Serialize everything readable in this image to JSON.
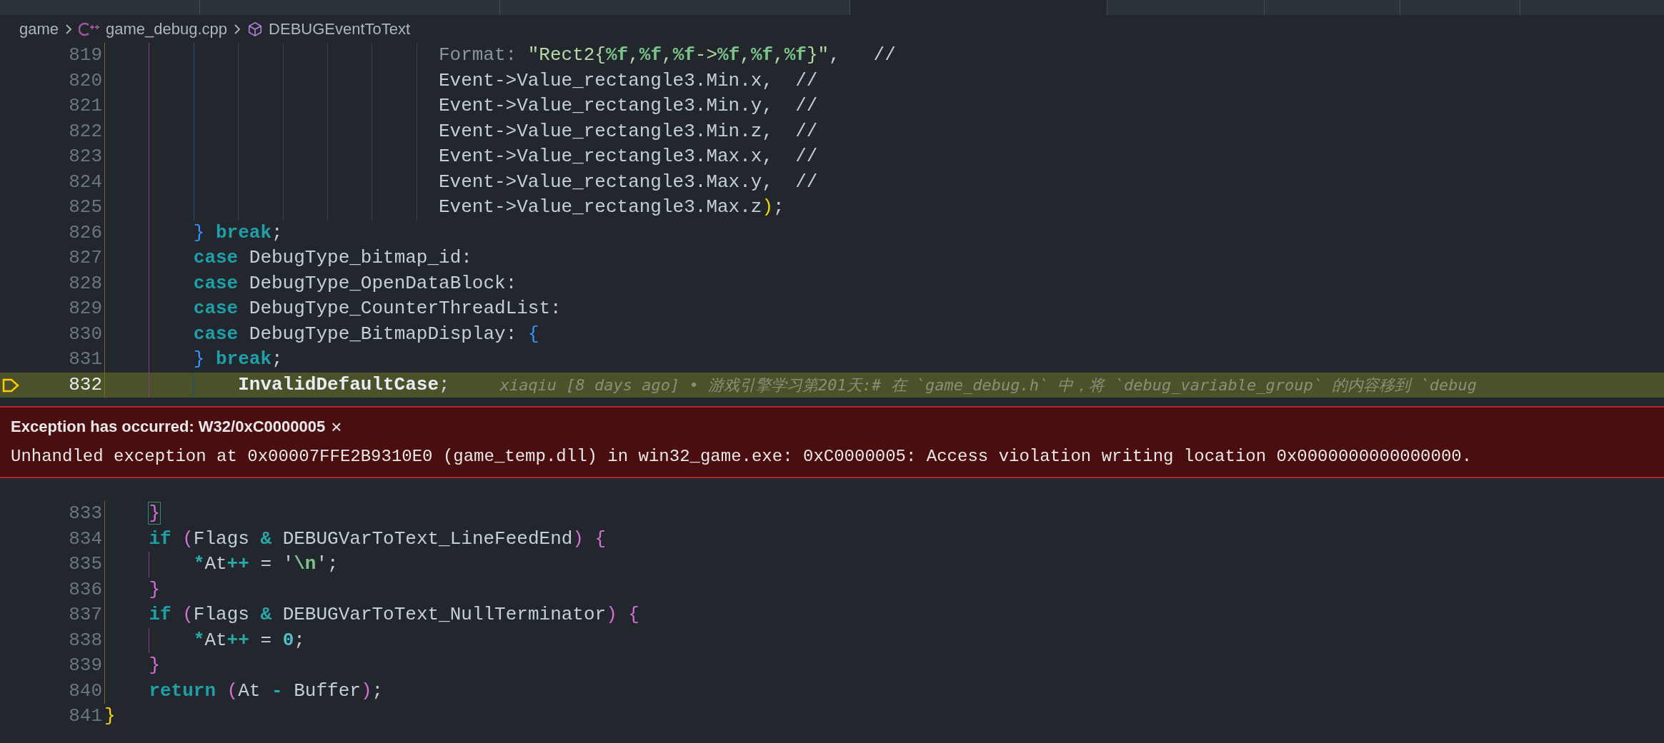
{
  "tabs": [
    {
      "selected": false
    },
    {
      "selected": false
    },
    {
      "selected": false
    },
    {
      "selected": true
    },
    {
      "selected": false
    },
    {
      "selected": false
    },
    {
      "selected": false
    }
  ],
  "breadcrumb": [
    {
      "label": "game",
      "kind": "folder"
    },
    {
      "label": "game_debug.cpp",
      "kind": "cpp-file"
    },
    {
      "label": "DEBUGEventToText",
      "kind": "symbol"
    }
  ],
  "code_before": [
    {
      "number": "819",
      "current": false,
      "tokens": [
        {
          "text": "                              Format:",
          "kind": "hint"
        },
        {
          "text": " \"Rect2{",
          "kind": "string"
        },
        {
          "text": "%f",
          "kind": "format"
        },
        {
          "text": ",",
          "kind": "string"
        },
        {
          "text": "%f",
          "kind": "format"
        },
        {
          "text": ",",
          "kind": "string"
        },
        {
          "text": "%f",
          "kind": "format"
        },
        {
          "text": "->",
          "kind": "string"
        },
        {
          "text": "%f",
          "kind": "format"
        },
        {
          "text": ",",
          "kind": "string"
        },
        {
          "text": "%f",
          "kind": "format"
        },
        {
          "text": ",",
          "kind": "string"
        },
        {
          "text": "%f",
          "kind": "format"
        },
        {
          "text": "}\"",
          "kind": "string"
        },
        {
          "text": ",   //",
          "kind": "plain"
        }
      ]
    },
    {
      "number": "820",
      "current": false,
      "tokens": [
        {
          "text": "                              Event->Value_rectangle3.Min.x,  //",
          "kind": "plain"
        }
      ]
    },
    {
      "number": "821",
      "current": false,
      "tokens": [
        {
          "text": "                              Event->Value_rectangle3.Min.y,  //",
          "kind": "plain"
        }
      ]
    },
    {
      "number": "822",
      "current": false,
      "tokens": [
        {
          "text": "                              Event->Value_rectangle3.Min.z,  //",
          "kind": "plain"
        }
      ]
    },
    {
      "number": "823",
      "current": false,
      "tokens": [
        {
          "text": "                              Event->Value_rectangle3.Max.x,  //",
          "kind": "plain"
        }
      ]
    },
    {
      "number": "824",
      "current": false,
      "tokens": [
        {
          "text": "                              Event->Value_rectangle3.Max.y,  //",
          "kind": "plain"
        }
      ]
    },
    {
      "number": "825",
      "current": false,
      "tokens": [
        {
          "text": "                              Event->Value_rectangle3.Max.z",
          "kind": "plain"
        },
        {
          "text": ")",
          "kind": "brace-yellow"
        },
        {
          "text": ";",
          "kind": "plain"
        }
      ]
    },
    {
      "number": "826",
      "current": false,
      "tokens": [
        {
          "text": "        }",
          "kind": "brace-blue"
        },
        {
          "text": " break",
          "kind": "keyword"
        },
        {
          "text": ";",
          "kind": "plain"
        }
      ]
    },
    {
      "number": "827",
      "current": false,
      "tokens": [
        {
          "text": "        case",
          "kind": "keyword"
        },
        {
          "text": " DebugType_bitmap_id:",
          "kind": "plain"
        }
      ]
    },
    {
      "number": "828",
      "current": false,
      "tokens": [
        {
          "text": "        case",
          "kind": "keyword"
        },
        {
          "text": " DebugType_OpenDataBlock:",
          "kind": "plain"
        }
      ]
    },
    {
      "number": "829",
      "current": false,
      "tokens": [
        {
          "text": "        case",
          "kind": "keyword"
        },
        {
          "text": " DebugType_CounterThreadList:",
          "kind": "plain"
        }
      ]
    },
    {
      "number": "830",
      "current": false,
      "tokens": [
        {
          "text": "        case",
          "kind": "keyword"
        },
        {
          "text": " DebugType_BitmapDisplay: ",
          "kind": "plain"
        },
        {
          "text": "{",
          "kind": "brace-blue"
        }
      ]
    },
    {
      "number": "831",
      "current": false,
      "tokens": [
        {
          "text": "        }",
          "kind": "brace-blue"
        },
        {
          "text": " break",
          "kind": "keyword"
        },
        {
          "text": ";",
          "kind": "plain"
        }
      ]
    },
    {
      "number": "832",
      "current": true,
      "tokens": [
        {
          "text": "            InvalidDefaultCase",
          "kind": "bold"
        },
        {
          "text": ";",
          "kind": "plain"
        }
      ],
      "blame": "xiaqiu [8 days ago] • 游戏引擎学习第201天:# 在 `game_debug.h` 中，将 `debug_variable_group` 的内容移到 `debug"
    }
  ],
  "exception": {
    "title": "Exception has occurred: W32/0xC0000005",
    "close": "×",
    "message": "Unhandled exception at 0x00007FFE2B9310E0 (game_temp.dll) in win32_game.exe: 0xC0000005: Access violation writing location 0x0000000000000000."
  },
  "code_after": [
    {
      "number": "833",
      "current": false,
      "tokens": [
        {
          "text": "    }",
          "kind": "brace-match"
        }
      ]
    },
    {
      "number": "834",
      "current": false,
      "tokens": [
        {
          "text": "    if",
          "kind": "keyword"
        },
        {
          "text": " (",
          "kind": "brace-pink"
        },
        {
          "text": "Flags ",
          "kind": "plain"
        },
        {
          "text": "&",
          "kind": "operator"
        },
        {
          "text": " DEBUGVarToText_LineFeedEnd",
          "kind": "plain"
        },
        {
          "text": ")",
          "kind": "brace-pink"
        },
        {
          "text": " {",
          "kind": "brace-pink"
        }
      ]
    },
    {
      "number": "835",
      "current": false,
      "tokens": [
        {
          "text": "        *",
          "kind": "operator"
        },
        {
          "text": "At",
          "kind": "plain"
        },
        {
          "text": "++",
          "kind": "operator"
        },
        {
          "text": " = '",
          "kind": "plain"
        },
        {
          "text": "\\n",
          "kind": "escape"
        },
        {
          "text": "';",
          "kind": "plain"
        }
      ]
    },
    {
      "number": "836",
      "current": false,
      "tokens": [
        {
          "text": "    }",
          "kind": "brace-pink"
        }
      ]
    },
    {
      "number": "837",
      "current": false,
      "tokens": [
        {
          "text": "    if",
          "kind": "keyword"
        },
        {
          "text": " (",
          "kind": "brace-pink"
        },
        {
          "text": "Flags ",
          "kind": "plain"
        },
        {
          "text": "&",
          "kind": "operator"
        },
        {
          "text": " DEBUGVarToText_NullTerminator",
          "kind": "plain"
        },
        {
          "text": ")",
          "kind": "brace-pink"
        },
        {
          "text": " {",
          "kind": "brace-pink"
        }
      ]
    },
    {
      "number": "838",
      "current": false,
      "tokens": [
        {
          "text": "        *",
          "kind": "operator"
        },
        {
          "text": "At",
          "kind": "plain"
        },
        {
          "text": "++",
          "kind": "operator"
        },
        {
          "text": " = ",
          "kind": "plain"
        },
        {
          "text": "0",
          "kind": "number"
        },
        {
          "text": ";",
          "kind": "plain"
        }
      ]
    },
    {
      "number": "839",
      "current": false,
      "tokens": [
        {
          "text": "    }",
          "kind": "brace-pink"
        }
      ]
    },
    {
      "number": "840",
      "current": false,
      "tokens": [
        {
          "text": "    return",
          "kind": "keyword"
        },
        {
          "text": " (",
          "kind": "brace-pink"
        },
        {
          "text": "At ",
          "kind": "plain"
        },
        {
          "text": "-",
          "kind": "operator"
        },
        {
          "text": " Buffer",
          "kind": "plain"
        },
        {
          "text": ")",
          "kind": "brace-pink"
        },
        {
          "text": ";",
          "kind": "plain"
        }
      ]
    },
    {
      "number": "841",
      "current": false,
      "tokens": [
        {
          "text": "}",
          "kind": "brace-yellow"
        }
      ]
    }
  ]
}
